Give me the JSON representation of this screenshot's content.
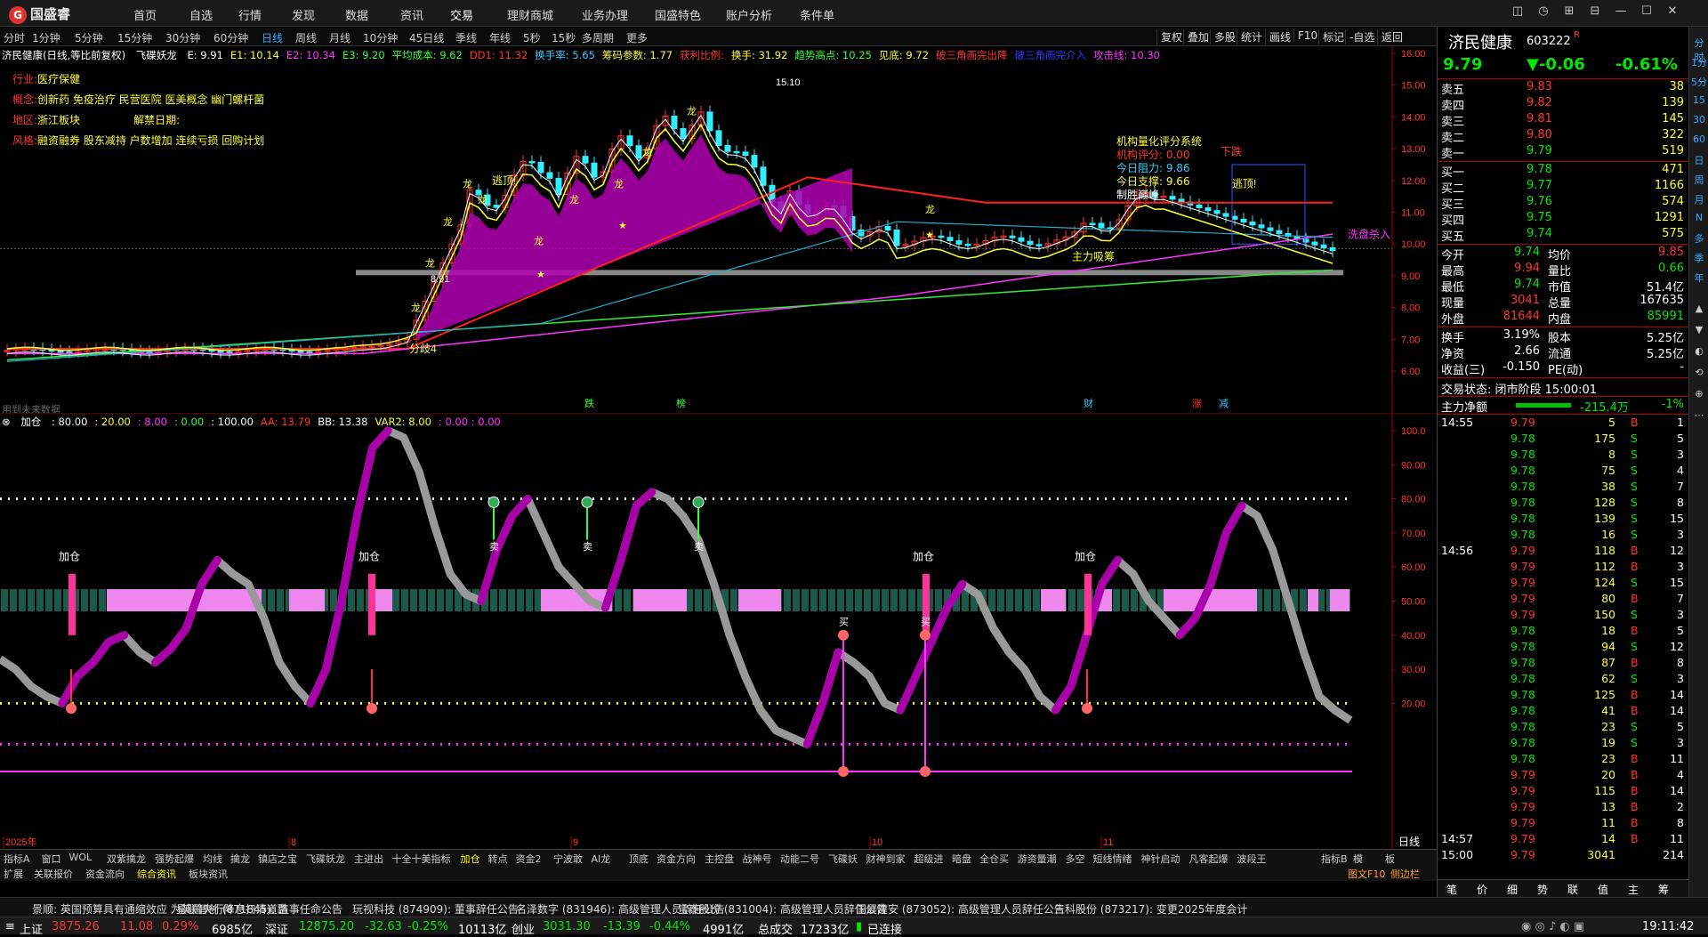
{
  "app": {
    "name": "国盛睿",
    "menu": [
      "首页",
      "自选",
      "行情",
      "发现",
      "数据",
      "资讯",
      "交易",
      "理财商城",
      "业务办理",
      "国盛特色",
      "账户分析",
      "条件单"
    ],
    "window_controls": [
      "chat-icon",
      "clock-icon",
      "layout-icon",
      "grid-icon",
      "minimize-icon",
      "maximize-icon",
      "close-icon"
    ]
  },
  "periods": [
    "分时",
    "1分钟",
    "5分钟",
    "15分钟",
    "30分钟",
    "60分钟",
    "日线",
    "周线",
    "月线",
    "10分钟",
    "45日线",
    "季线",
    "年线",
    "5秒",
    "15秒",
    "多周期",
    "更多"
  ],
  "toolbar": [
    "复权",
    "叠加",
    "多股",
    "统计",
    "画线",
    "F10",
    "标记",
    "-自选",
    "返回"
  ],
  "main_info": {
    "stock_title": "济民健康(日线,等比前复权)",
    "indicator_name": "飞碟妖龙",
    "items": [
      {
        "label": "E: 9.91",
        "color": "#ffffff"
      },
      {
        "label": "E1: 10.14",
        "color": "#ffff33"
      },
      {
        "label": "E2: 10.34",
        "color": "#ff33ff"
      },
      {
        "label": "E3: 9.20",
        "color": "#33ff33"
      },
      {
        "label": "平均成本: 9.62",
        "color": "#33ff33"
      },
      {
        "label": "DD1: 11.32",
        "color": "#ff3333"
      },
      {
        "label": "换手率: 5.65",
        "color": "#33ccff"
      },
      {
        "label": "筹码参数: 1.77",
        "color": "#ffff33"
      },
      {
        "label": "获利比例:",
        "color": "#ff3333"
      },
      {
        "label": "换手: 31.92",
        "color": "#ffff33"
      },
      {
        "label": "趋势高点: 10.25",
        "color": "#33ff33"
      },
      {
        "label": "见底: 9.72",
        "color": "#ffff33"
      },
      {
        "label": "破三角画完出降",
        "color": "#ff3333"
      },
      {
        "label": "破三角画完介入",
        "color": "#3333ff"
      },
      {
        "label": "攻击线: 10.30",
        "color": "#ff33ff"
      }
    ]
  },
  "stock_profile": {
    "industry_label": "行业:",
    "industry": "医疗保健",
    "concept_label": "概念:",
    "concept": "创新药 免疫治疗 民营医院 医美概念 幽门螺杆菌",
    "region_label": "地区:",
    "region": "浙江板块",
    "unlock_label": "解禁日期:",
    "style_label": "风格:",
    "style": "融资融券 股东减持 户数增加 连续亏损 回购计划"
  },
  "rating_box": {
    "title": "机构量化评分系统",
    "score": "机构评分: 0.00",
    "resistance": "今日阻力: 9.86",
    "support": "今日支撑: 9.66",
    "status": "制胜巅峰"
  },
  "chart_labels": {
    "price_high": "15.10",
    "price_low": "8.91",
    "watermark": "用到未来数据",
    "main_force": "主力吸筹",
    "wash": "洗盘杀入",
    "divergence": "分歧4",
    "escape1": "逃顶!",
    "escape2": "逃顶!",
    "fall": "下跌",
    "dragon": "龙",
    "star": "★",
    "bottom_marks": [
      "跌",
      "榜",
      "财",
      "涨",
      "减"
    ]
  },
  "price_axis": [
    "16.00",
    "15.00",
    "14.00",
    "13.00",
    "12.00",
    "11.00",
    "10.00",
    "9.00",
    "8.00",
    "7.00",
    "6.00"
  ],
  "sub_info": {
    "name": "加仓",
    "items": [
      {
        "label": ": 80.00",
        "color": "#ffffff"
      },
      {
        "label": ": 20.00",
        "color": "#ffff33"
      },
      {
        "label": ": 8.00",
        "color": "#ff33ff"
      },
      {
        "label": ": 0.00",
        "color": "#33ff33"
      },
      {
        "label": ": 100.00",
        "color": "#ffffff"
      },
      {
        "label": "AA: 13.79",
        "color": "#ff3333"
      },
      {
        "label": "BB: 13.38",
        "color": "#ffffff"
      },
      {
        "label": "VAR2: 8.00",
        "color": "#ffff33"
      },
      {
        "label": ": 0.00 : 0.00",
        "color": "#ff33ff"
      }
    ]
  },
  "sub_axis": [
    "100.0",
    "90.00",
    "80.00",
    "70.00",
    "60.00",
    "50.00",
    "40.00",
    "30.00",
    "20.00"
  ],
  "sub_labels": {
    "add": "加仓",
    "sell": "卖",
    "buy": "买"
  },
  "x_axis": [
    "2025年",
    "8",
    "9",
    "10",
    "11"
  ],
  "x_axis_right": "日线",
  "tabs1": [
    "指标A",
    "窗口",
    "WOL",
    "双紫擒龙",
    "强势起爆",
    "均线",
    "擒龙",
    "镇店之宝",
    "飞碟妖龙",
    "主进出",
    "十全十美指标",
    "加仓",
    "转点",
    "资金2",
    "宁波敢",
    "AI龙",
    "顶底",
    "资金方向",
    "主控盘",
    "战神号",
    "动能二号",
    "飞碟妖",
    "财神到家",
    "超级进",
    "暗盘",
    "全仓买",
    "游资量潮",
    "多空",
    "短线情绪",
    "神针启动",
    "凡客起爆",
    "波段王"
  ],
  "tabs1_right": [
    "指标B",
    "模",
    "板"
  ],
  "tabs2": [
    "扩展",
    "关联报价",
    "资金流向",
    "综合资讯",
    "板块资讯"
  ],
  "tabs2_right": [
    "图文F10",
    "侧边栏"
  ],
  "quote": {
    "name": "济民健康",
    "code": "603222",
    "badge": "R",
    "price": "9.79",
    "change": "▼-0.06",
    "change_pct": "-0.61%",
    "asks": [
      {
        "label": "卖五",
        "price": "9.83",
        "vol": "38"
      },
      {
        "label": "卖四",
        "price": "9.82",
        "vol": "139"
      },
      {
        "label": "卖三",
        "price": "9.81",
        "vol": "145"
      },
      {
        "label": "卖二",
        "price": "9.80",
        "vol": "322"
      },
      {
        "label": "卖一",
        "price": "9.79",
        "vol": "519"
      }
    ],
    "bids": [
      {
        "label": "买一",
        "price": "9.78",
        "vol": "471"
      },
      {
        "label": "买二",
        "price": "9.77",
        "vol": "1166"
      },
      {
        "label": "买三",
        "price": "9.76",
        "vol": "574"
      },
      {
        "label": "买四",
        "price": "9.75",
        "vol": "1291"
      },
      {
        "label": "买五",
        "price": "9.74",
        "vol": "575"
      }
    ],
    "stats": [
      {
        "l1": "今开",
        "v1": "9.74",
        "c1": "green",
        "l2": "均价",
        "v2": "9.85",
        "c2": "red"
      },
      {
        "l1": "最高",
        "v1": "9.94",
        "c1": "red",
        "l2": "量比",
        "v2": "0.66",
        "c2": "green"
      },
      {
        "l1": "最低",
        "v1": "9.74",
        "c1": "green",
        "l2": "市值",
        "v2": "51.4亿",
        "c2": "white"
      },
      {
        "l1": "现量",
        "v1": "3041",
        "c1": "red",
        "l2": "总量",
        "v2": "167635",
        "c2": "white"
      },
      {
        "l1": "外盘",
        "v1": "81644",
        "c1": "red",
        "l2": "内盘",
        "v2": "85991",
        "c2": "green"
      }
    ],
    "stats2": [
      {
        "l1": "换手",
        "v1": "3.19%",
        "l2": "股本",
        "v2": "5.25亿"
      },
      {
        "l1": "净资",
        "v1": "2.66",
        "l2": "流通",
        "v2": "5.25亿"
      },
      {
        "l1": "收益(三)",
        "v1": "-0.150",
        "l2": "PE(动)",
        "v2": "-"
      }
    ],
    "trade_status": "交易状态: 闭市阶段 15:00:01",
    "main_net_label": "主力净额",
    "main_net": "-215.4万",
    "main_net_pct": "-1%"
  },
  "ticks": [
    {
      "time": "14:55",
      "price": "9.79",
      "vol": "5",
      "bs": "B",
      "n": "1"
    },
    {
      "time": "",
      "price": "9.78",
      "vol": "175",
      "bs": "S",
      "n": "5"
    },
    {
      "time": "",
      "price": "9.78",
      "vol": "8",
      "bs": "S",
      "n": "3"
    },
    {
      "time": "",
      "price": "9.78",
      "vol": "75",
      "bs": "S",
      "n": "4"
    },
    {
      "time": "",
      "price": "9.78",
      "vol": "38",
      "bs": "S",
      "n": "7"
    },
    {
      "time": "",
      "price": "9.78",
      "vol": "128",
      "bs": "S",
      "n": "8"
    },
    {
      "time": "",
      "price": "9.78",
      "vol": "139",
      "bs": "S",
      "n": "15"
    },
    {
      "time": "",
      "price": "9.78",
      "vol": "16",
      "bs": "S",
      "n": "3"
    },
    {
      "time": "14:56",
      "price": "9.79",
      "vol": "118",
      "bs": "B",
      "n": "12"
    },
    {
      "time": "",
      "price": "9.79",
      "vol": "112",
      "bs": "B",
      "n": "3"
    },
    {
      "time": "",
      "price": "9.79",
      "vol": "124",
      "bs": "S",
      "n": "15"
    },
    {
      "time": "",
      "price": "9.79",
      "vol": "80",
      "bs": "B",
      "n": "7"
    },
    {
      "time": "",
      "price": "9.79",
      "vol": "150",
      "bs": "S",
      "n": "3"
    },
    {
      "time": "",
      "price": "9.78",
      "vol": "18",
      "bs": "B",
      "n": "5"
    },
    {
      "time": "",
      "price": "9.78",
      "vol": "94",
      "bs": "S",
      "n": "12"
    },
    {
      "time": "",
      "price": "9.78",
      "vol": "87",
      "bs": "B",
      "n": "8"
    },
    {
      "time": "",
      "price": "9.78",
      "vol": "62",
      "bs": "S",
      "n": "3"
    },
    {
      "time": "",
      "price": "9.78",
      "vol": "125",
      "bs": "B",
      "n": "14"
    },
    {
      "time": "",
      "price": "9.78",
      "vol": "41",
      "bs": "B",
      "n": "14"
    },
    {
      "time": "",
      "price": "9.78",
      "vol": "23",
      "bs": "S",
      "n": "5"
    },
    {
      "time": "",
      "price": "9.78",
      "vol": "19",
      "bs": "S",
      "n": "3"
    },
    {
      "time": "",
      "price": "9.78",
      "vol": "23",
      "bs": "B",
      "n": "11"
    },
    {
      "time": "",
      "price": "9.79",
      "vol": "20",
      "bs": "B",
      "n": "4"
    },
    {
      "time": "",
      "price": "9.79",
      "vol": "115",
      "bs": "B",
      "n": "14"
    },
    {
      "time": "",
      "price": "9.79",
      "vol": "13",
      "bs": "B",
      "n": "2"
    },
    {
      "time": "",
      "price": "9.79",
      "vol": "11",
      "bs": "B",
      "n": "8"
    },
    {
      "time": "14:57",
      "price": "9.79",
      "vol": "14",
      "bs": "B",
      "n": "11"
    },
    {
      "time": "15:00",
      "price": "9.79",
      "vol": "3041",
      "bs": "",
      "n": "214"
    }
  ],
  "rpanel_tabs": [
    "笔",
    "价",
    "细",
    "势",
    "联",
    "值",
    "主",
    "筹"
  ],
  "side_strip": [
    "分时",
    "1分",
    "5分",
    "15",
    "30",
    "60",
    "日",
    "周",
    "月",
    "N",
    "多",
    "季",
    "年"
  ],
  "news": [
    "景顺: 英国预算具有通缩效应 为英国央行降息扫清道路",
    "星联智创 (871845): 监事任命公告",
    "玩视科技 (874909): 董事辞任公告",
    "名泽数字 (831946): 高级管理人员辞任公告",
    "宝泰股份 (831004): 高级管理人员辞任公告",
    "国展建安 (873052): 高级管理人员辞任公告",
    "三科股份 (873217): 变更2025年度会计"
  ],
  "status_bar": {
    "sh_label": "上证",
    "sh": "3875.26",
    "sh_chg": "11.08",
    "sh_pct": "0.29%",
    "sh_amt": "6985亿",
    "sz_label": "深证",
    "sz": "12875.20",
    "sz_chg": "-32.63",
    "sz_pct": "-0.25%",
    "sz_amt": "10113亿",
    "cy_label": "创业",
    "cy": "3031.30",
    "cy_chg": "-13.39",
    "cy_pct": "-0.44%",
    "cy_amt": "4991亿",
    "total_label": "总成交",
    "total": "17233亿",
    "conn": "已连接",
    "time": "19:11:42"
  }
}
